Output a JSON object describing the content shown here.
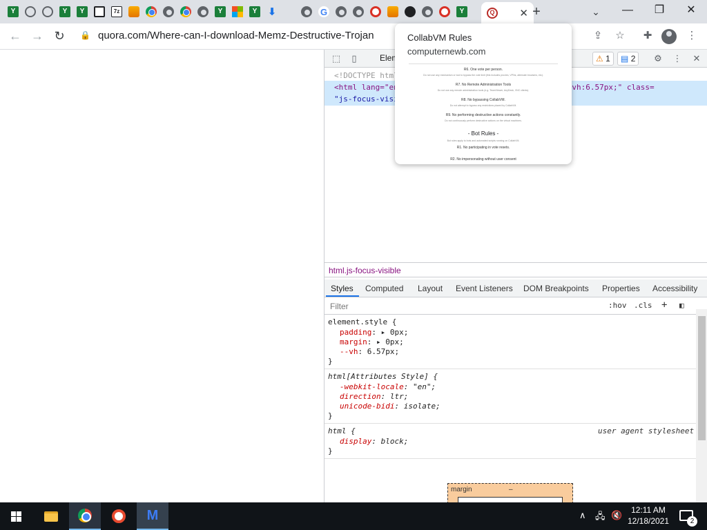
{
  "browser": {
    "tabs": [
      {
        "icon": "green-y-icon",
        "glyph": "Y"
      },
      {
        "icon": "globe-icon",
        "glyph": ""
      },
      {
        "icon": "globe-icon",
        "glyph": ""
      },
      {
        "icon": "green-y-icon",
        "glyph": "Y"
      },
      {
        "icon": "green-y-icon",
        "glyph": "Y"
      },
      {
        "icon": "square-logo-icon",
        "glyph": ""
      },
      {
        "icon": "7zip-icon",
        "glyph": "7z"
      },
      {
        "icon": "cat-icon",
        "glyph": ""
      },
      {
        "icon": "chrome-icon",
        "glyph": ""
      },
      {
        "icon": "chrome-grey-icon",
        "glyph": ""
      },
      {
        "icon": "chrome-icon",
        "glyph": ""
      },
      {
        "icon": "chrome-grey-icon",
        "glyph": ""
      },
      {
        "icon": "green-y-icon",
        "glyph": "Y"
      },
      {
        "icon": "microsoft-icon",
        "glyph": ""
      },
      {
        "icon": "green-y-icon",
        "glyph": "Y"
      },
      {
        "icon": "download-icon",
        "glyph": "⬇"
      },
      {
        "icon": "apple-icon",
        "glyph": ""
      },
      {
        "icon": "chrome-grey-icon",
        "glyph": ""
      },
      {
        "icon": "google-icon",
        "glyph": "G"
      },
      {
        "icon": "chrome-grey-icon",
        "glyph": ""
      },
      {
        "icon": "chrome-grey-icon",
        "glyph": ""
      },
      {
        "icon": "red-swirl-icon",
        "glyph": ""
      },
      {
        "icon": "cat-icon",
        "glyph": ""
      },
      {
        "icon": "ninja-icon",
        "glyph": ""
      },
      {
        "icon": "chrome-grey-icon",
        "glyph": ""
      },
      {
        "icon": "red-swirl-icon",
        "glyph": ""
      },
      {
        "icon": "green-y-icon",
        "glyph": "Y"
      }
    ],
    "active_tab": {
      "icon": "quora-icon",
      "glyph": "Q",
      "close": "✕"
    },
    "new_tab": "+",
    "tab_search": "⌄",
    "window": {
      "minimize": "—",
      "restore": "❐",
      "close": "✕"
    },
    "nav": {
      "back": "←",
      "forward": "→",
      "reload": "↻"
    },
    "url": "quora.com/Where-can-I-download-Memz-Destructive-Trojan",
    "toolbar_icons": {
      "share": "⇪",
      "star": "☆",
      "extensions": "✚",
      "menu": "⋮"
    }
  },
  "popup": {
    "title": "CollabVM Rules",
    "domain": "computernewb.com",
    "thumbnail": {
      "headings": [
        "R6. One vote per person.",
        "R7. No Remote Administration Tools",
        "R8. No bypassing CollabVM.",
        "R9. No performing destructive actions constantly."
      ],
      "paragraphs": [
        "Do not use any mechanism or tool to bypass the vote limit (this includes proxies, VPNs, alternate browsers, etc).",
        "Do not use any remote administration tools (e.g. TeamViewer, AnyDesk, VNC clients).",
        "Do not attempt to bypass any restrictions placed by CollabVM.",
        "Do not continuously perform destructive actions on the virtual machines."
      ],
      "bot_heading": "- Bot Rules -",
      "bot_intro": "Bot rules apply to bots and automated scripts running on CollabVM.",
      "bot_items": [
        "R1. No participating in vote resets.",
        "R2. No impersonating without user consent"
      ]
    }
  },
  "devtools": {
    "elements_tab": "Elements",
    "warnings": "1",
    "messages": "2",
    "dom": {
      "doctype": "<!DOCTYPE html>",
      "html_line1": "<html lang=\"en\" style=\"padding: 0px; margin: 0px; --vh:6.57px;\" class=",
      "html_line2": "\"js-focus-visible\"> == $0"
    },
    "breadcrumb": "html.js-focus-visible",
    "style_tabs": [
      "Styles",
      "Computed",
      "Layout",
      "Event Listeners",
      "DOM Breakpoints",
      "Properties",
      "Accessibility"
    ],
    "filter_placeholder": "Filter",
    "hov": ":hov",
    "cls": ".cls",
    "add": "+",
    "rules": {
      "r1_selector": "element.style {",
      "r1_p1": "padding",
      "r1_v1": "0px;",
      "r1_p2": "margin",
      "r1_v2": "0px;",
      "r1_p3": "--vh",
      "r1_v3": "6.57px;",
      "r2_selector": "html[Attributes Style] {",
      "r2_p1": "-webkit-locale",
      "r2_v1": "\"en\";",
      "r2_p2": "direction",
      "r2_v2": "ltr;",
      "r2_p3": "unicode-bidi",
      "r2_v3": "isolate;",
      "r3_selector": "html {",
      "r3_source": "user agent stylesheet",
      "r3_p1": "display",
      "r3_v1": "block;",
      "close_brace": "}"
    },
    "boxmodel": {
      "label": "margin",
      "dash": "–"
    }
  },
  "taskbar": {
    "time": "12:11 AM",
    "date": "12/18/2021",
    "notifications": "2",
    "tray": {
      "chevron": "∧",
      "network": "🖧",
      "volume": "🔇"
    }
  }
}
